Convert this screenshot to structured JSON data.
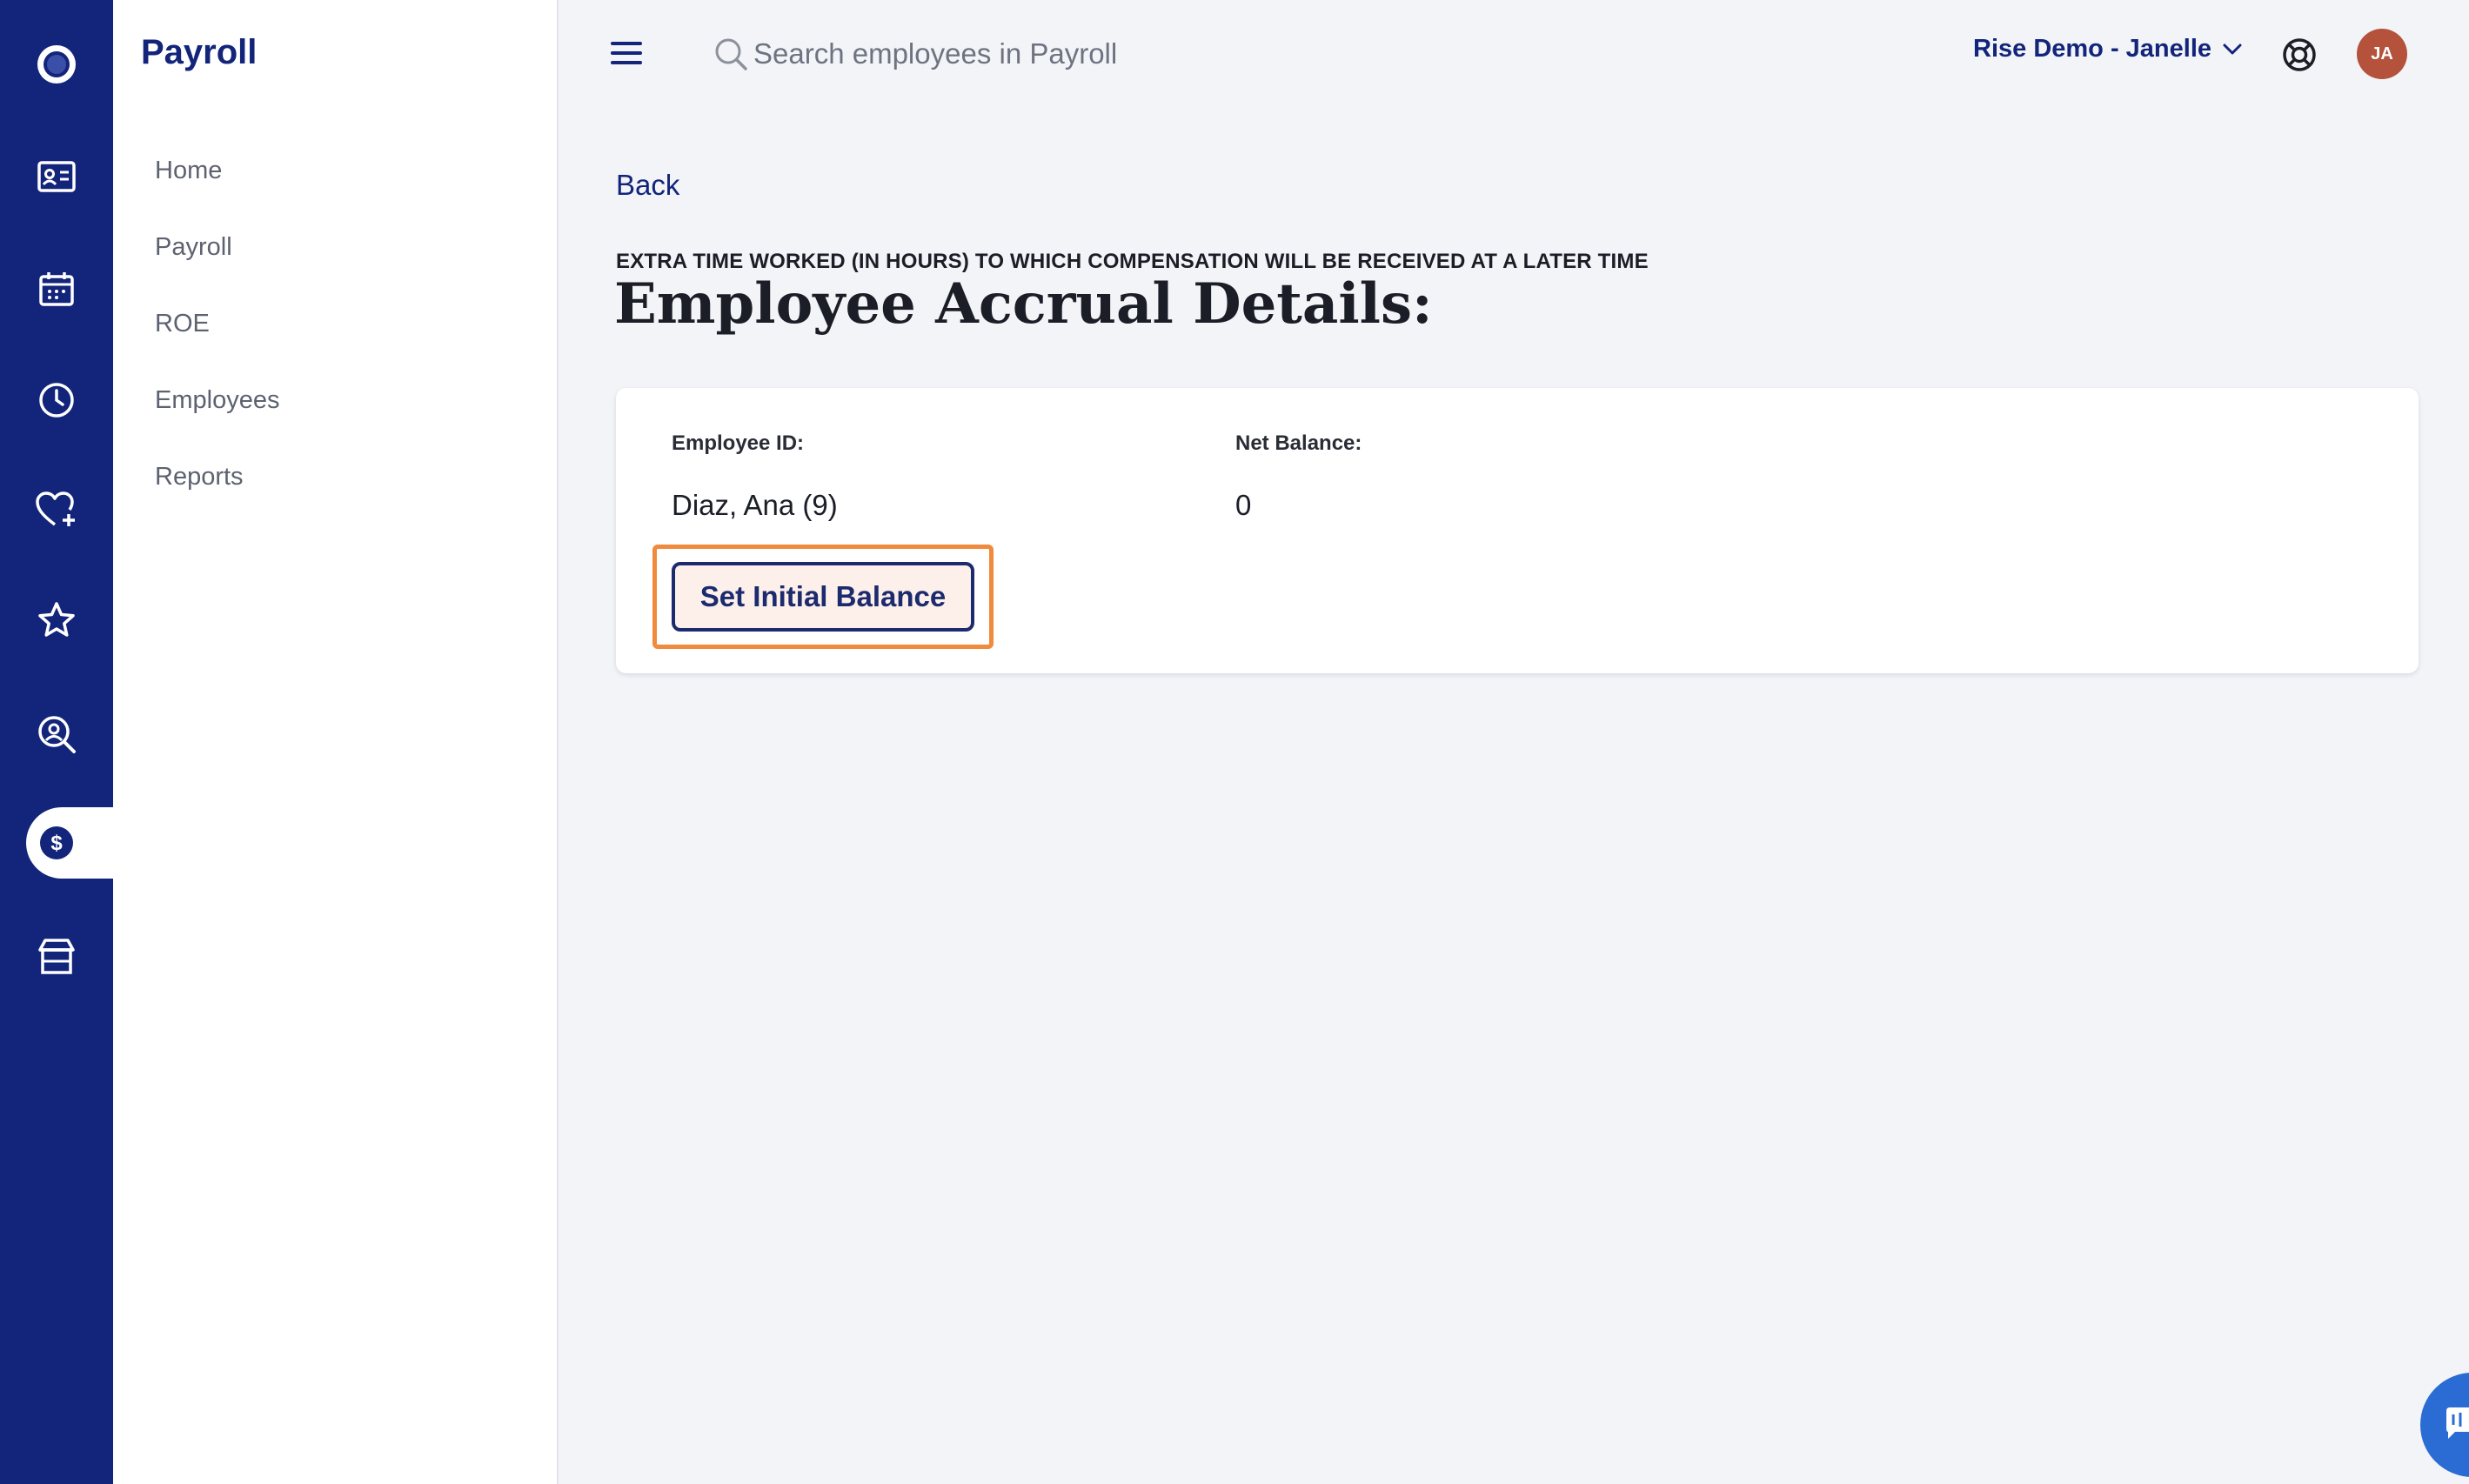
{
  "rail": {
    "icons": [
      "logo-icon",
      "id-card-icon",
      "calendar-icon",
      "clock-icon",
      "heart-plus-icon",
      "star-icon",
      "person-search-icon",
      "dollar-icon",
      "shop-icon"
    ],
    "active": "dollar-icon",
    "color": "#13257a"
  },
  "sidenav": {
    "title": "Payroll",
    "items": [
      {
        "label": "Home"
      },
      {
        "label": "Payroll"
      },
      {
        "label": "ROE"
      },
      {
        "label": "Employees"
      },
      {
        "label": "Reports"
      }
    ]
  },
  "topbar": {
    "search_placeholder": "Search employees in Payroll",
    "account_label": "Rise Demo - Janelle",
    "avatar_initials": "JA"
  },
  "main": {
    "back_label": "Back",
    "overline": "EXTRA TIME WORKED (IN HOURS) TO WHICH COMPENSATION WILL BE RECEIVED AT A LATER TIME",
    "title": "Employee Accrual Details:",
    "card": {
      "employee_id_label": "Employee ID:",
      "employee_id_value": "Diaz, Ana (9)",
      "net_balance_label": "Net Balance:",
      "net_balance_value": "0",
      "set_balance_button": "Set Initial Balance"
    }
  },
  "colors": {
    "brand": "#13257a",
    "highlight": "#f08a3c",
    "avatar": "#b4523c",
    "chat": "#2a6cd4"
  }
}
